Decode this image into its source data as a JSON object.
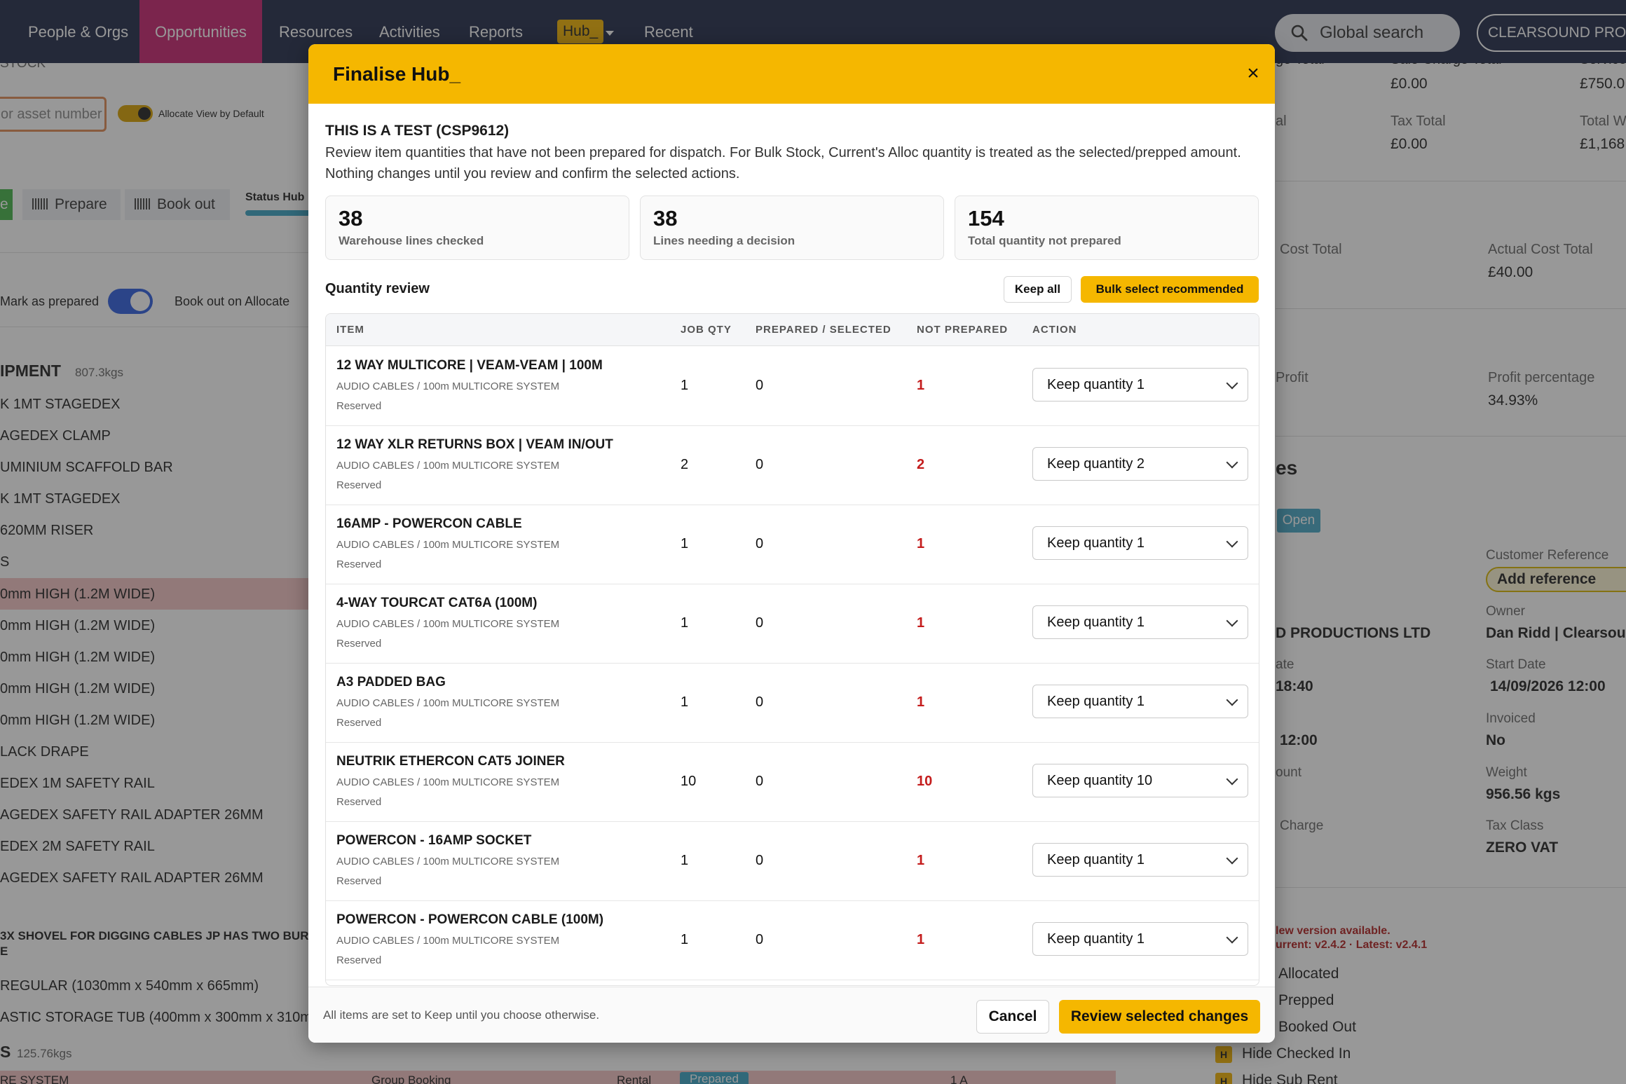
{
  "nav": {
    "items": [
      "People & Orgs",
      "Opportunities",
      "Resources",
      "Activities",
      "Reports"
    ],
    "hub_label": "Hub_",
    "recent": "Recent",
    "search_placeholder": "Global search",
    "company": "CLEARSOUND PRODUCTIONS"
  },
  "bg": {
    "stock_header": "STOCK******",
    "asset_placeholder": "or asset number",
    "allocate_toggle": "Allocate View by Default",
    "tabs": [
      "e",
      "Prepare",
      "Book out"
    ],
    "status_hub": "Status Hub",
    "mark_prepared": "Mark as prepared",
    "book_out_alloc": "Book out on Allocate",
    "section_title": "IPMENT",
    "section_weight": "807.3kgs",
    "rows": [
      "K 1MT STAGEDEX",
      "AGEDEX CLAMP",
      "UMINIUM SCAFFOLD BAR",
      "K 1MT STAGEDEX",
      "620MM RISER",
      "S",
      "0mm HIGH (1.2M WIDE)",
      "0mm HIGH (1.2M WIDE)",
      "0mm HIGH (1.2M WIDE)",
      "0mm HIGH (1.2M WIDE)",
      "0mm HIGH (1.2M WIDE)",
      "LACK DRAPE",
      "EDEX 1M SAFETY RAIL",
      "AGEDEX SAFETY RAIL ADAPTER 26MM",
      "EDEX 2M SAFETY RAIL",
      "AGEDEX SAFETY RAIL ADAPTER 26MM"
    ],
    "shovel_note": "3X SHOVEL FOR DIGGING CABLES JP HAS TWO BUR",
    "shovel_note_cont": "E",
    "regular": "REGULAR (1030mm x 540mm x 665mm)",
    "tub": "ASTIC STORAGE TUB (400mm x 300mm x 310m",
    "s_weight_title": "S",
    "s_weight": "125.76kgs",
    "bottom_frag": [
      "RE SYSTEM",
      "Group Booking",
      "Rental",
      "Prepared",
      "1 A"
    ],
    "right": {
      "sale_charge_total_lbl": "Sale Charge Total",
      "sale_charge_total": "£0.00",
      "tax_total_lbl": "Tax Total",
      "tax_total": "£0.00",
      "service_lbl": "Service",
      "service_val": "£750.0",
      "total_w_lbl": "Total W",
      "total_w_val": "£1,168.",
      "charge_total_frag": "ge Total",
      "al_frag": "al",
      "cost_total_lbl": "Cost Total",
      "actual_cost_total_lbl": "Actual Cost Total",
      "actual_cost_total": "£40.00",
      "profit_lbl": "Profit",
      "profit_pct_lbl": "Profit percentage",
      "profit_pct": "34.93%",
      "es_frag": "es",
      "open_badge": "Open",
      "cust_ref_lbl": "Customer Reference",
      "add_ref": "Add reference",
      "owner_lbl": "Owner",
      "owner": "Dan Ridd | Clearsound",
      "org_frag": "D PRODUCTIONS LTD",
      "ate_frag": "ate",
      "time1": "18:40",
      "start_lbl": "Start Date",
      "start": "14/09/2026 12:00",
      "time2": "12:00",
      "invoiced_lbl": "Invoiced",
      "invoiced": "No",
      "ount_frag": "ount",
      "weight_lbl": "Weight",
      "weight": "956.56 kgs",
      "charge_frag": "Charge",
      "taxclass_lbl": "Tax Class",
      "taxclass": "ZERO VAT",
      "version1": "lew version available.",
      "version2": "urrent: v2.4.2 · Latest: v2.4.1",
      "legend": [
        "Allocated",
        "Prepped",
        "Booked Out",
        "Hide Checked In",
        "Hide Sub Rent"
      ],
      "legend_h": "H"
    }
  },
  "modal": {
    "title": "Finalise Hub_",
    "close": "×",
    "job": "THIS IS A TEST (CSP9612)",
    "description": "Review item quantities that have not been prepared for dispatch. For Bulk Stock, Current's Alloc quantity is treated as the selected/prepped amount. Nothing changes until you review and confirm the selected actions.",
    "stats": [
      {
        "value": "38",
        "label": "Warehouse lines checked"
      },
      {
        "value": "38",
        "label": "Lines needing a decision"
      },
      {
        "value": "154",
        "label": "Total quantity not prepared"
      }
    ],
    "quantity_review": "Quantity review",
    "keep_all": "Keep all",
    "bulk_select": "Bulk select recommended",
    "columns": {
      "item": "ITEM",
      "job_qty": "JOB QTY",
      "prepared": "PREPARED / SELECTED",
      "not_prepared": "NOT PREPARED",
      "action": "ACTION"
    },
    "rows": [
      {
        "name": "12 WAY MULTICORE | VEAM-VEAM | 100M",
        "category": "AUDIO CABLES / 100m MULTICORE SYSTEM",
        "status": "Reserved",
        "job_qty": "1",
        "prepared": "0",
        "not_prepared": "1",
        "action": "Keep quantity 1"
      },
      {
        "name": "12 WAY XLR RETURNS BOX | VEAM IN/OUT",
        "category": "AUDIO CABLES / 100m MULTICORE SYSTEM",
        "status": "Reserved",
        "job_qty": "2",
        "prepared": "0",
        "not_prepared": "2",
        "action": "Keep quantity 2"
      },
      {
        "name": "16AMP - POWERCON CABLE",
        "category": "AUDIO CABLES / 100m MULTICORE SYSTEM",
        "status": "Reserved",
        "job_qty": "1",
        "prepared": "0",
        "not_prepared": "1",
        "action": "Keep quantity 1"
      },
      {
        "name": "4-WAY TOURCAT CAT6A (100M)",
        "category": "AUDIO CABLES / 100m MULTICORE SYSTEM",
        "status": "Reserved",
        "job_qty": "1",
        "prepared": "0",
        "not_prepared": "1",
        "action": "Keep quantity 1"
      },
      {
        "name": "A3 PADDED BAG",
        "category": "AUDIO CABLES / 100m MULTICORE SYSTEM",
        "status": "Reserved",
        "job_qty": "1",
        "prepared": "0",
        "not_prepared": "1",
        "action": "Keep quantity 1"
      },
      {
        "name": "NEUTRIK ETHERCON CAT5 JOINER",
        "category": "AUDIO CABLES / 100m MULTICORE SYSTEM",
        "status": "Reserved",
        "job_qty": "10",
        "prepared": "0",
        "not_prepared": "10",
        "action": "Keep quantity 10"
      },
      {
        "name": "POWERCON - 16AMP SOCKET",
        "category": "AUDIO CABLES / 100m MULTICORE SYSTEM",
        "status": "Reserved",
        "job_qty": "1",
        "prepared": "0",
        "not_prepared": "1",
        "action": "Keep quantity 1"
      },
      {
        "name": "POWERCON - POWERCON CABLE (100M)",
        "category": "AUDIO CABLES / 100m MULTICORE SYSTEM",
        "status": "Reserved",
        "job_qty": "1",
        "prepared": "0",
        "not_prepared": "1",
        "action": "Keep quantity 1"
      }
    ],
    "footer_note": "All items are set to Keep until you choose otherwise.",
    "cancel": "Cancel",
    "review": "Review selected changes"
  },
  "colors": {
    "nav_bg": "#222b49",
    "accent_pink": "#c8236f",
    "accent_yellow": "#f5b700",
    "not_prepared_red": "#c41c1c"
  }
}
